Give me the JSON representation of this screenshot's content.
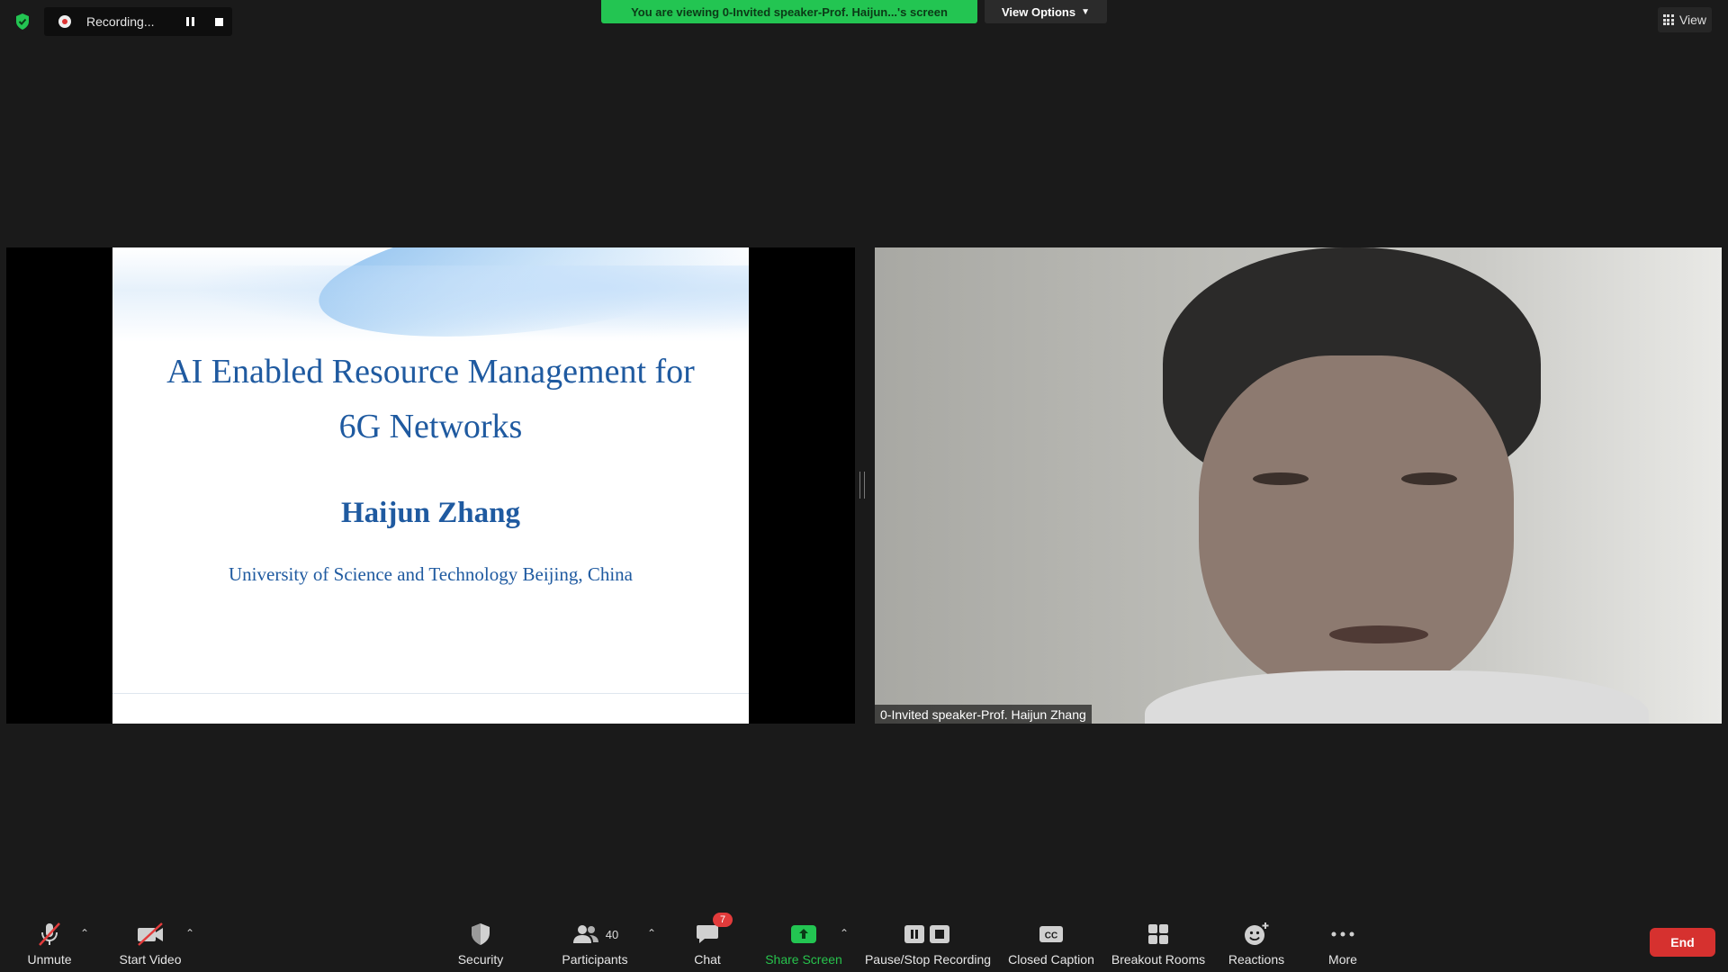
{
  "top_bar": {
    "recording_text": "Recording...",
    "viewing_banner": "You are viewing 0-Invited speaker-Prof. Haijun...'s screen",
    "view_options_label": "View Options",
    "view_label": "View"
  },
  "slide": {
    "title_line1": "AI Enabled Resource Management for",
    "title_line2": "6G Networks",
    "author": "Haijun Zhang",
    "affiliation": "University of Science and Technology Beijing, China"
  },
  "video": {
    "participant_name": "0-Invited speaker-Prof. Haijun Zhang"
  },
  "toolbar": {
    "unmute": "Unmute",
    "start_video": "Start Video",
    "security": "Security",
    "participants": "Participants",
    "participants_count": "40",
    "chat": "Chat",
    "chat_badge": "7",
    "share_screen": "Share Screen",
    "pause_stop_recording": "Pause/Stop Recording",
    "closed_caption": "Closed Caption",
    "breakout_rooms": "Breakout Rooms",
    "reactions": "Reactions",
    "more": "More",
    "end": "End"
  },
  "colors": {
    "background": "#1a1a1a",
    "banner_green": "#23c552",
    "slide_blue": "#1f5aa0",
    "end_red": "#d6312f",
    "badge_red": "#e23b3b"
  }
}
